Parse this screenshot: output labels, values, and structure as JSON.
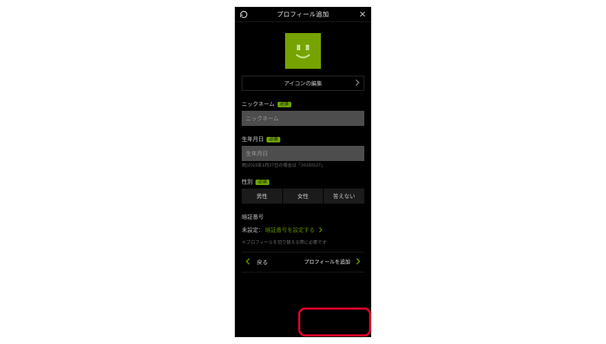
{
  "header": {
    "title": "プロフィール追加"
  },
  "avatar": {
    "edit_label": "アイコンの編集"
  },
  "nickname": {
    "label": "ニックネーム",
    "required_badge": "必須",
    "placeholder": "ニックネーム"
  },
  "birthday": {
    "label": "生年月日",
    "required_badge": "必須",
    "placeholder": "生年月日",
    "hint": "例)2015年1月27日の場合は「20150127」"
  },
  "gender": {
    "label": "性別",
    "required_badge": "必須",
    "options": {
      "male": "男性",
      "female": "女性",
      "no_answer": "答えない"
    }
  },
  "pin": {
    "label": "暗証番号",
    "unset_prefix": "未設定：",
    "set_link": "暗証番号を設定する",
    "note": "※プロフィールを切り替える際に必要です"
  },
  "footer": {
    "back": "戻る",
    "add": "プロフィールを追加"
  }
}
